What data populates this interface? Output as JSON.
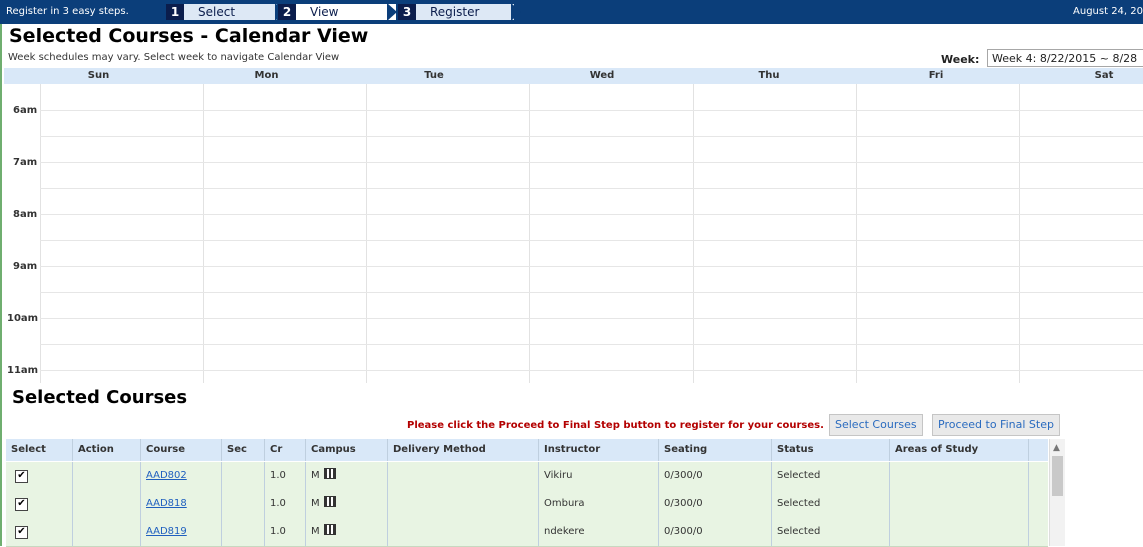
{
  "topbar": {
    "steps_text": "Register in 3 easy steps.",
    "date": "August 24, 20",
    "steps": [
      {
        "num": "1",
        "label": "Select"
      },
      {
        "num": "2",
        "label": "View"
      },
      {
        "num": "3",
        "label": "Register"
      }
    ]
  },
  "page": {
    "title": "Selected Courses - Calendar View",
    "subtext": "Week schedules may vary. Select week to navigate Calendar View",
    "week_label": "Week:",
    "week_value": "Week 4: 8/22/2015 ~ 8/28"
  },
  "calendar": {
    "days": [
      "Sun",
      "Mon",
      "Tue",
      "Wed",
      "Thu",
      "Fri",
      "Sat"
    ],
    "hours": [
      "6am",
      "7am",
      "8am",
      "9am",
      "10am",
      "11am"
    ]
  },
  "courses": {
    "title": "Selected Courses",
    "notice": "Please click the Proceed to Final Step button to register for your courses.",
    "select_courses_button": "Select Courses",
    "proceed_button": "Proceed to Final Step",
    "columns": [
      "Select",
      "Action",
      "Course",
      "Sec",
      "Cr",
      "Campus",
      "Delivery Method",
      "Instructor",
      "Seating",
      "Status",
      "Areas of Study"
    ],
    "rows": [
      {
        "checked": "✔",
        "course": "AAD802",
        "cr": "1.0",
        "campus": "M",
        "instructor": "Vikiru",
        "seating": "0/300/0",
        "status": "Selected"
      },
      {
        "checked": "✔",
        "course": "AAD818",
        "cr": "1.0",
        "campus": "M",
        "instructor": "Ombura",
        "seating": "0/300/0",
        "status": "Selected"
      },
      {
        "checked": "✔",
        "course": "AAD819",
        "cr": "1.0",
        "campus": "M",
        "instructor": "ndekere",
        "seating": "0/300/0",
        "status": "Selected"
      }
    ]
  }
}
